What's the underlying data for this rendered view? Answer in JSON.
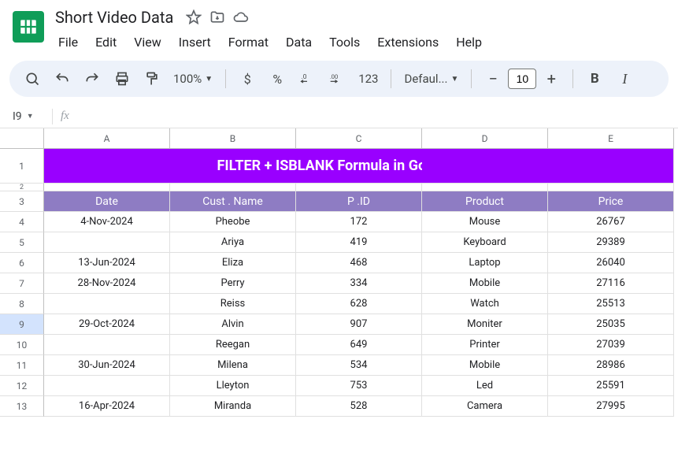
{
  "doc": {
    "title": "Short Video Data"
  },
  "menu": {
    "file": "File",
    "edit": "Edit",
    "view": "View",
    "insert": "Insert",
    "format": "Format",
    "data": "Data",
    "tools": "Tools",
    "extensions": "Extensions",
    "help": "Help"
  },
  "toolbar": {
    "zoom": "100%",
    "currency": "$",
    "percent": "%",
    "dec_minus": ".0",
    "dec_plus": ".00",
    "numfmt": "123",
    "font": "Defaul...",
    "font_size": "10",
    "bold": "B",
    "italic": "I"
  },
  "namebox": {
    "ref": "I9",
    "fx": "fx",
    "formula": ""
  },
  "cols": {
    "A": "A",
    "B": "B",
    "C": "C",
    "D": "D",
    "E": "E"
  },
  "row_nums": [
    "1",
    "2",
    "3",
    "4",
    "5",
    "6",
    "7",
    "8",
    "9",
    "10",
    "11",
    "12",
    "13"
  ],
  "banner": "FILTER + ISBLANK Formula in Google Sheets",
  "headers": {
    "date": "Date",
    "cust": "Cust . Name",
    "pid": "P .ID",
    "product": "Product",
    "price": "Price"
  },
  "rows": [
    {
      "date": "4-Nov-2024",
      "cust": "Pheobe",
      "pid": "172",
      "product": "Mouse",
      "price": "26767"
    },
    {
      "date": "",
      "cust": "Ariya",
      "pid": "419",
      "product": "Keyboard",
      "price": "29389"
    },
    {
      "date": "13-Jun-2024",
      "cust": "Eliza",
      "pid": "468",
      "product": "Laptop",
      "price": "26040"
    },
    {
      "date": "28-Nov-2024",
      "cust": "Perry",
      "pid": "334",
      "product": "Mobile",
      "price": "27116"
    },
    {
      "date": "",
      "cust": "Reiss",
      "pid": "628",
      "product": "Watch",
      "price": "25513"
    },
    {
      "date": "29-Oct-2024",
      "cust": "Alvin",
      "pid": "907",
      "product": "Moniter",
      "price": "25035"
    },
    {
      "date": "",
      "cust": "Reegan",
      "pid": "649",
      "product": "Printer",
      "price": "27039"
    },
    {
      "date": "30-Jun-2024",
      "cust": "Milena",
      "pid": "534",
      "product": "Mobile",
      "price": "28986"
    },
    {
      "date": "",
      "cust": "Lleyton",
      "pid": "753",
      "product": "Led",
      "price": "25591"
    },
    {
      "date": "16-Apr-2024",
      "cust": "Miranda",
      "pid": "528",
      "product": "Camera",
      "price": "27995"
    }
  ],
  "chart_data": {
    "type": "table",
    "title": "FILTER + ISBLANK Formula in Google Sheets",
    "columns": [
      "Date",
      "Cust . Name",
      "P .ID",
      "Product",
      "Price"
    ],
    "rows": [
      [
        "4-Nov-2024",
        "Pheobe",
        172,
        "Mouse",
        26767
      ],
      [
        "",
        "Ariya",
        419,
        "Keyboard",
        29389
      ],
      [
        "13-Jun-2024",
        "Eliza",
        468,
        "Laptop",
        26040
      ],
      [
        "28-Nov-2024",
        "Perry",
        334,
        "Mobile",
        27116
      ],
      [
        "",
        "Reiss",
        628,
        "Watch",
        25513
      ],
      [
        "29-Oct-2024",
        "Alvin",
        907,
        "Moniter",
        25035
      ],
      [
        "",
        "Reegan",
        649,
        "Printer",
        27039
      ],
      [
        "30-Jun-2024",
        "Milena",
        534,
        "Mobile",
        28986
      ],
      [
        "",
        "Lleyton",
        753,
        "Led",
        25591
      ],
      [
        "16-Apr-2024",
        "Miranda",
        528,
        "Camera",
        27995
      ]
    ]
  }
}
